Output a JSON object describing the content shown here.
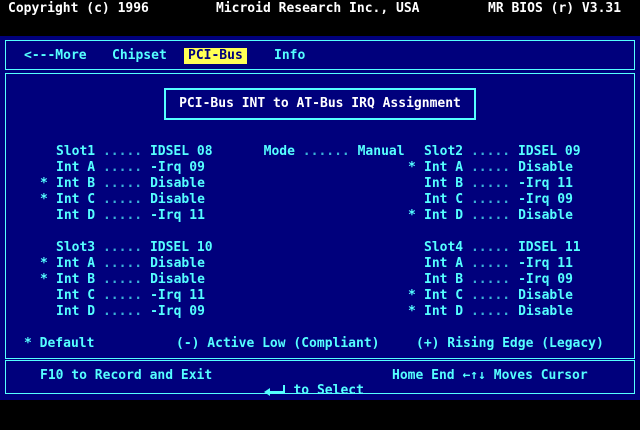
{
  "top": {
    "copyright": "Copyright (c) 1996",
    "vendor": "Microid Research Inc., USA",
    "product": "MR BIOS (r)  V3.31"
  },
  "menu": {
    "more": "<---More",
    "chipset": "Chipset",
    "pci_bus": "PCI-Bus",
    "info": "Info"
  },
  "section_title": "PCI-Bus INT to AT-Bus IRQ Assignment",
  "mode": {
    "label": "Mode",
    "dots": "......",
    "value": "Manual"
  },
  "slots": [
    {
      "slot": "Slot1",
      "idsel": "IDSEL 08",
      "ints": [
        {
          "mark": "",
          "name": "Int A",
          "value": "-Irq 09"
        },
        {
          "mark": "*",
          "name": "Int B",
          "value": "Disable"
        },
        {
          "mark": "*",
          "name": "Int C",
          "value": "Disable"
        },
        {
          "mark": "",
          "name": "Int D",
          "value": "-Irq 11"
        }
      ]
    },
    {
      "slot": "Slot2",
      "idsel": "IDSEL 09",
      "ints": [
        {
          "mark": "*",
          "name": "Int A",
          "value": "Disable"
        },
        {
          "mark": "",
          "name": "Int B",
          "value": "-Irq 11"
        },
        {
          "mark": "",
          "name": "Int C",
          "value": "-Irq 09"
        },
        {
          "mark": "*",
          "name": "Int D",
          "value": "Disable"
        }
      ]
    },
    {
      "slot": "Slot3",
      "idsel": "IDSEL 10",
      "ints": [
        {
          "mark": "*",
          "name": "Int A",
          "value": "Disable"
        },
        {
          "mark": "*",
          "name": "Int B",
          "value": "Disable"
        },
        {
          "mark": "",
          "name": "Int C",
          "value": "-Irq 11"
        },
        {
          "mark": "",
          "name": "Int D",
          "value": "-Irq 09"
        }
      ]
    },
    {
      "slot": "Slot4",
      "idsel": "IDSEL 11",
      "ints": [
        {
          "mark": "",
          "name": "Int A",
          "value": "-Irq 11"
        },
        {
          "mark": "",
          "name": "Int B",
          "value": "-Irq 09"
        },
        {
          "mark": "*",
          "name": "Int C",
          "value": "Disable"
        },
        {
          "mark": "*",
          "name": "Int D",
          "value": "Disable"
        }
      ]
    }
  ],
  "dots": ".....",
  "legend": {
    "default": "* Default",
    "active_low": "(-) Active Low (Compliant)",
    "rising_edge": "(+) Rising Edge (Legacy)"
  },
  "footer": {
    "f10": "F10 to Record and Exit",
    "select": "to Select",
    "cursor_prefix": "Home End",
    "cursor_arrows": "←↑↓",
    "cursor_suffix": "Moves Cursor",
    "enter_icon": "enter-key-icon"
  },
  "colors": {
    "background": "#00007c",
    "text": "#55ffff",
    "highlight": "#ffff55",
    "title": "#ffffff"
  }
}
